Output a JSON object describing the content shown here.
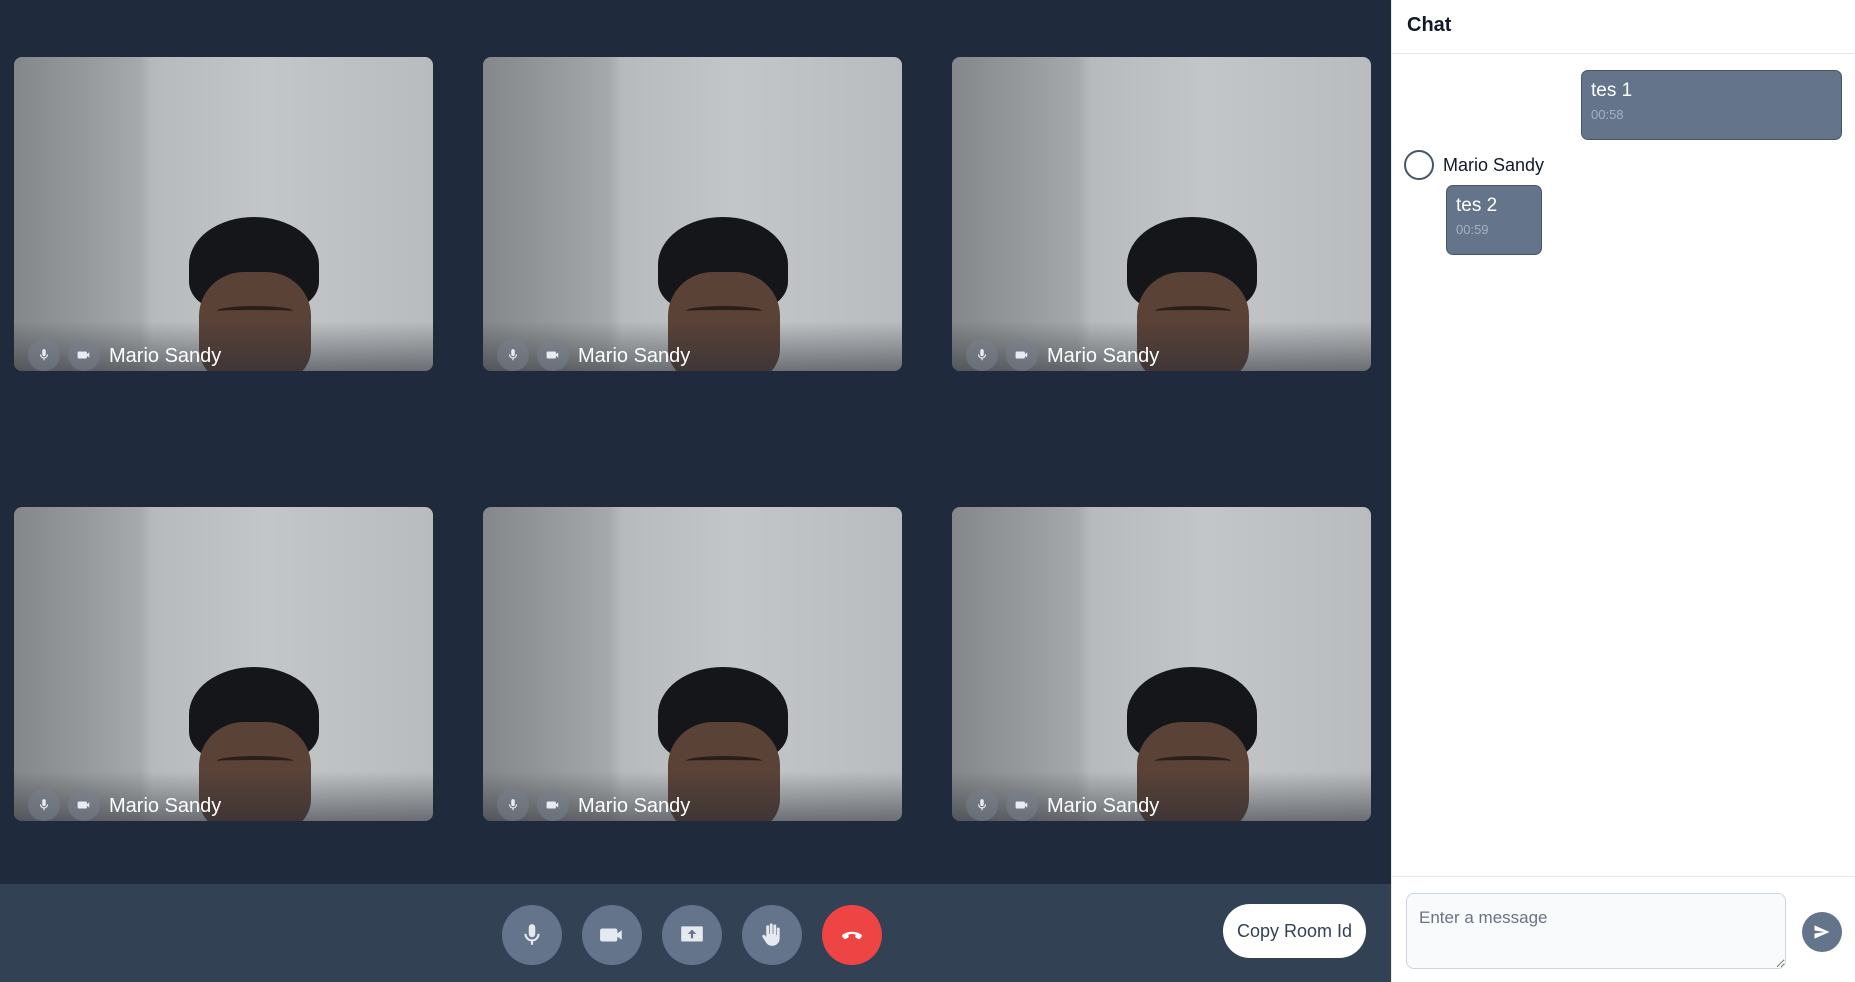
{
  "participants": [
    {
      "name": "Mario Sandy"
    },
    {
      "name": "Mario Sandy"
    },
    {
      "name": "Mario Sandy"
    },
    {
      "name": "Mario Sandy"
    },
    {
      "name": "Mario Sandy"
    },
    {
      "name": "Mario Sandy"
    }
  ],
  "toolbar": {
    "buttons": [
      "microphone-icon",
      "video-camera-icon",
      "share-screen-icon",
      "raise-hand-icon",
      "end-call-icon"
    ],
    "copy_room_label": "Copy Room Id",
    "end_call_color": "#ef4444"
  },
  "chat": {
    "title": "Chat",
    "messages": [
      {
        "text": "tes 1",
        "time": "00:58",
        "own": true
      },
      {
        "sender": "Mario Sandy",
        "text": "tes 2",
        "time": "00:59",
        "own": false
      }
    ],
    "input_placeholder": "Enter a message",
    "send_icon": "send-icon"
  }
}
